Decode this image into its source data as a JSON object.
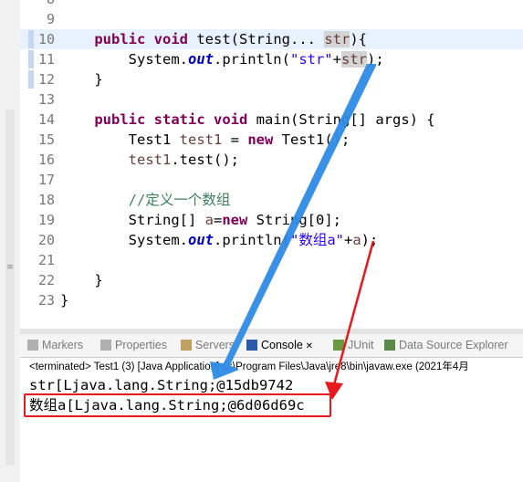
{
  "editor": {
    "lines": [
      {
        "num": "8",
        "segs": []
      },
      {
        "num": "9",
        "segs": []
      },
      {
        "num": "10",
        "segs": [
          {
            "t": "    "
          },
          {
            "t": "public",
            "c": "kw"
          },
          {
            "t": " "
          },
          {
            "t": "void",
            "c": "kw"
          },
          {
            "t": " test(String... "
          },
          {
            "t": "str",
            "c": "var hlsel"
          },
          {
            "t": "){"
          }
        ]
      },
      {
        "num": "11",
        "segs": [
          {
            "t": "        System."
          },
          {
            "t": "out",
            "c": "fld"
          },
          {
            "t": ".println("
          },
          {
            "t": "\"str\"",
            "c": "str"
          },
          {
            "t": "+"
          },
          {
            "t": "str",
            "c": "var hlsel"
          },
          {
            "t": ");"
          }
        ]
      },
      {
        "num": "12",
        "segs": [
          {
            "t": "    }"
          }
        ]
      },
      {
        "num": "13",
        "segs": []
      },
      {
        "num": "14",
        "segs": [
          {
            "t": "    "
          },
          {
            "t": "public",
            "c": "kw"
          },
          {
            "t": " "
          },
          {
            "t": "static",
            "c": "kw"
          },
          {
            "t": " "
          },
          {
            "t": "void",
            "c": "kw"
          },
          {
            "t": " main(String[] args) {"
          }
        ]
      },
      {
        "num": "15",
        "segs": [
          {
            "t": "        Test1 "
          },
          {
            "t": "test1",
            "c": "var"
          },
          {
            "t": " = "
          },
          {
            "t": "new",
            "c": "kw"
          },
          {
            "t": " Test1();"
          }
        ]
      },
      {
        "num": "16",
        "segs": [
          {
            "t": "        "
          },
          {
            "t": "test1",
            "c": "var"
          },
          {
            "t": ".test();"
          }
        ]
      },
      {
        "num": "17",
        "segs": []
      },
      {
        "num": "18",
        "segs": [
          {
            "t": "        "
          },
          {
            "t": "//定义一个数组",
            "c": "cmt"
          }
        ]
      },
      {
        "num": "19",
        "segs": [
          {
            "t": "        String[] "
          },
          {
            "t": "a",
            "c": "var"
          },
          {
            "t": "="
          },
          {
            "t": "new",
            "c": "kw"
          },
          {
            "t": " String[0];"
          }
        ]
      },
      {
        "num": "20",
        "segs": [
          {
            "t": "        System."
          },
          {
            "t": "out",
            "c": "fld"
          },
          {
            "t": ".println("
          },
          {
            "t": "\"数组a\"",
            "c": "str"
          },
          {
            "t": "+"
          },
          {
            "t": "a",
            "c": "var"
          },
          {
            "t": ");"
          }
        ]
      },
      {
        "num": "21",
        "segs": []
      },
      {
        "num": "22",
        "segs": [
          {
            "t": "    }"
          }
        ]
      },
      {
        "num": "23",
        "segs": [
          {
            "t": "}"
          }
        ]
      }
    ]
  },
  "tabs": [
    {
      "label": "Markers",
      "icon": "markers-icon",
      "color": "#b0b0b0"
    },
    {
      "label": "Properties",
      "icon": "properties-icon",
      "color": "#b0b0b0"
    },
    {
      "label": "Servers",
      "icon": "servers-icon",
      "color": "#c0a060"
    },
    {
      "label": "Console",
      "icon": "console-icon",
      "color": "#2d5aa8",
      "active": true
    },
    {
      "label": "JUnit",
      "icon": "junit-icon",
      "color": "#6a9a40"
    },
    {
      "label": "Data Source Explorer",
      "icon": "data-source-explorer-icon",
      "color": "#5a8a4a"
    }
  ],
  "console": {
    "terminated": "<terminated> Test1 (3) [Java Application] C:\\Program Files\\Java\\jre8\\bin\\javaw.exe (2021年4月",
    "output1": "str[Ljava.lang.String;@15db9742",
    "output2": "数组a[Ljava.lang.String;@6d06d69c"
  },
  "colors": {
    "keyword": "#7f0055",
    "string": "#2a00ff",
    "comment": "#3f7f5f",
    "blue_arrow": "#2e8be6",
    "red_arrow": "#e8191c"
  }
}
